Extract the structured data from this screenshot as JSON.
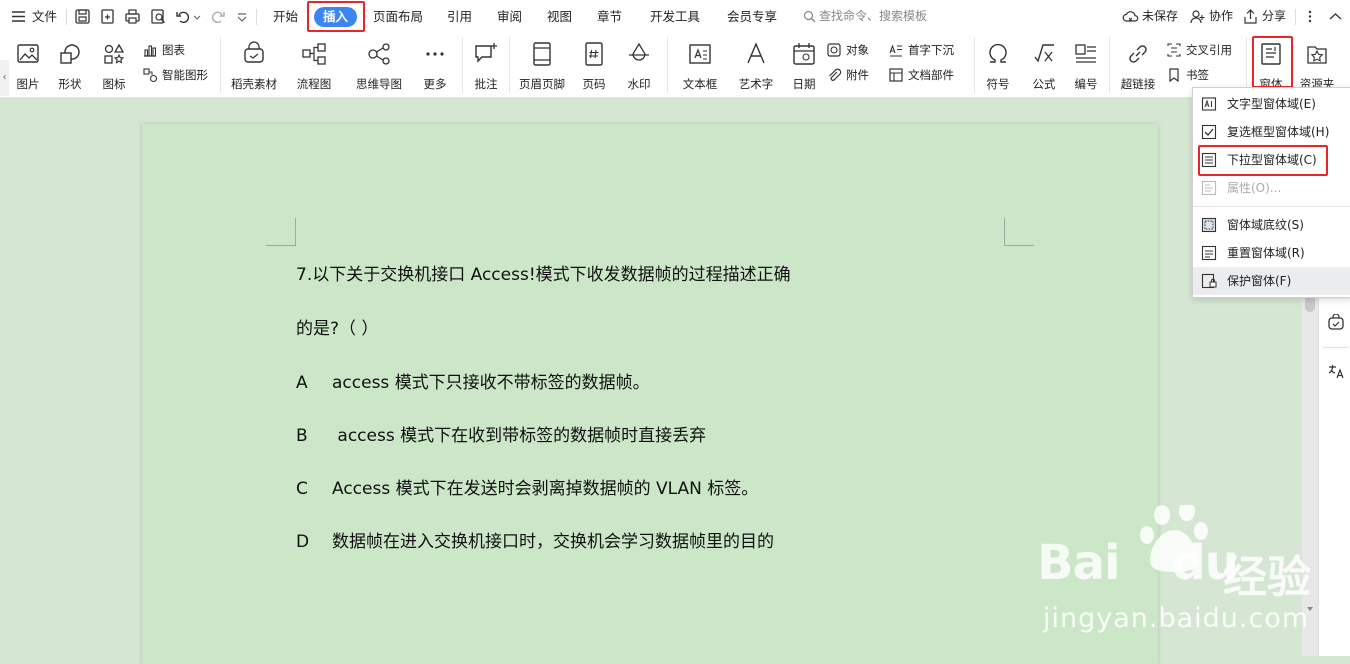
{
  "menubar": {
    "file": "文件",
    "tabs": [
      "开始",
      "插入",
      "页面布局",
      "引用",
      "审阅",
      "视图",
      "章节",
      "开发工具",
      "会员专享"
    ],
    "active_tab": "插入",
    "search_placeholder": "查找命令、搜索模板",
    "unsaved": "未保存",
    "collab": "协作",
    "share": "分享"
  },
  "ribbon": {
    "picture": "图片",
    "shape": "形状",
    "icon": "图标",
    "chart": "图表",
    "smart_graphic": "智能图形",
    "daoke": "稻壳素材",
    "flowchart": "流程图",
    "mindmap": "思维导图",
    "more": "更多",
    "comment": "批注",
    "header_footer": "页眉页脚",
    "page_number": "页码",
    "watermark": "水印",
    "textbox": "文本框",
    "wordart": "艺术字",
    "date": "日期",
    "object": "对象",
    "attachment": "附件",
    "drop_cap": "首字下沉",
    "doc_parts": "文档部件",
    "symbol": "符号",
    "formula": "公式",
    "numbering": "编号",
    "hyperlink": "超链接",
    "cross_ref": "交叉引用",
    "bookmark": "书签",
    "form": "窗体",
    "resource": "资源夹"
  },
  "form_menu": {
    "items": [
      {
        "label": "文字型窗体域(E)",
        "icon": "text-field-icon"
      },
      {
        "label": "复选框型窗体域(H)",
        "icon": "checkbox-icon"
      },
      {
        "label": "下拉型窗体域(C)",
        "icon": "dropdown-list-icon"
      },
      {
        "label": "属性(O)...",
        "icon": "properties-icon"
      },
      {
        "label": "窗体域底纹(S)",
        "icon": "field-shading-icon"
      },
      {
        "label": "重置窗体域(R)",
        "icon": "reset-field-icon"
      },
      {
        "label": "保护窗体(F)",
        "icon": "protect-form-icon"
      }
    ],
    "highlighted": "下拉型窗体域(C)"
  },
  "document": {
    "question_line1": "7.以下关于交换机接口  Access!模式下收发数据帧的过程描述正确",
    "question_line2": "的是?（ ）",
    "options": [
      {
        "letter": "A",
        "text": "access  模式下只接收不带标签的数据帧。"
      },
      {
        "letter": "B",
        "text": " access  模式下在收到带标签的数据帧时直接丢弃"
      },
      {
        "letter": "C",
        "text": "Access  模式下在发送时会剥离掉数据帧的  VLAN  标签。"
      },
      {
        "letter": "D",
        "text": "数据帧在进入交换机接口时，交换机会学习数据帧里的目的"
      }
    ]
  },
  "watermark": {
    "brand": "Bai",
    "brand2": "du",
    "cn": "经验",
    "url": "jingyan.baidu.com"
  },
  "colors": {
    "accent": "#3d86f2",
    "highlight_box": "#e8262a",
    "page_bg": "#cce6c8",
    "canvas_bg": "#d5e7d2"
  }
}
